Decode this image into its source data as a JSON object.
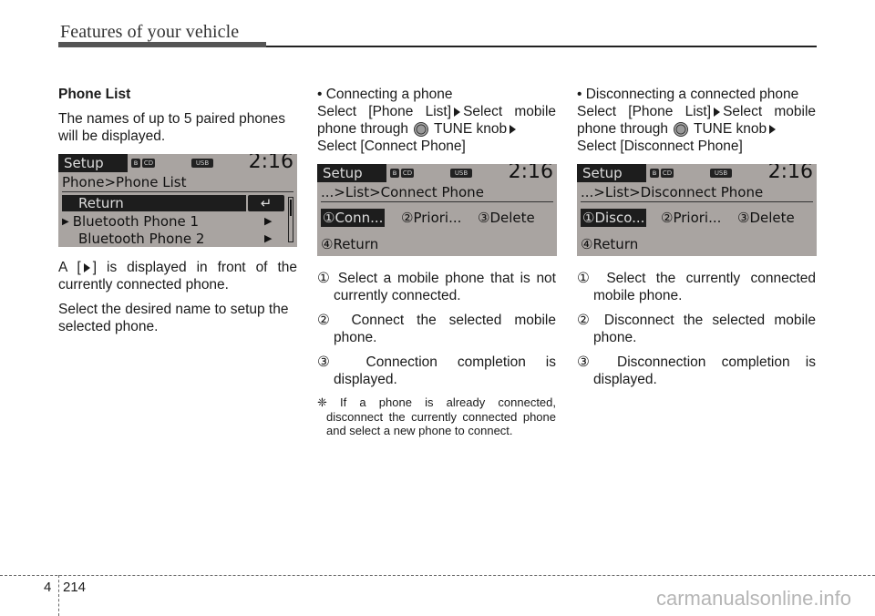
{
  "header": {
    "title": "Features of your vehicle"
  },
  "col1": {
    "heading": "Phone List",
    "intro": "The names of up to 5 paired phones will be displayed.",
    "screen": {
      "mode": "Setup",
      "icons": [
        "bluetooth-icon",
        "cd-icon",
        "usb-icon"
      ],
      "cd_label": "CD",
      "usb_label": "USB",
      "bt_label": "ʙ",
      "clock": "2:16",
      "path": "Phone>Phone List",
      "rows": [
        {
          "label": "Return",
          "selected": true,
          "right": "↵"
        },
        {
          "label": "Bluetooth Phone 1",
          "connected": true,
          "right": "▶"
        },
        {
          "label": "Bluetooth Phone 2",
          "connected": false,
          "right": "▶"
        }
      ],
      "scroll_position": 0
    },
    "note1_a": "A [",
    "note1_b": "] is displayed in front of the currently connected phone.",
    "note2": "Select the desired name to setup the selected phone."
  },
  "col2": {
    "bullet": "• Connecting a phone",
    "instr_a": "Select [Phone List]",
    "instr_b": "Select mobile phone through",
    "instr_c": "TUNE knob",
    "instr_d": "Select [Connect Phone]",
    "screen": {
      "mode": "Setup",
      "cd_label": "CD",
      "usb_label": "USB",
      "bt_label": "ʙ",
      "clock": "2:16",
      "path": "...>List>Connect Phone",
      "options": [
        "①Conn...",
        "②Priori...",
        "③Delete",
        "④Return"
      ]
    },
    "steps": [
      "① Select a mobile phone that is not currently connected.",
      "② Connect the selected mobile phone.",
      "③ Connection completion is displayed."
    ],
    "note": "❈ If a phone is already connected, disconnect the currently connected phone and select a new phone to connect."
  },
  "col3": {
    "bullet": "• Disconnecting a connected phone",
    "instr_a": "Select [Phone List]",
    "instr_b": "Select mobile phone through",
    "instr_c": "TUNE knob",
    "instr_d": "Select [Disconnect Phone]",
    "screen": {
      "mode": "Setup",
      "cd_label": "CD",
      "usb_label": "USB",
      "bt_label": "ʙ",
      "clock": "2:16",
      "path": "...>List>Disconnect Phone",
      "options": [
        "①Disco...",
        "②Priori...",
        "③Delete",
        "④Return"
      ]
    },
    "steps": [
      "① Select the currently connected mobile phone.",
      "② Disconnect the selected mobile phone.",
      "③ Disconnection completion is displayed."
    ]
  },
  "footer": {
    "chapter": "4",
    "page": "214",
    "watermark": "carmanualsonline.info"
  }
}
